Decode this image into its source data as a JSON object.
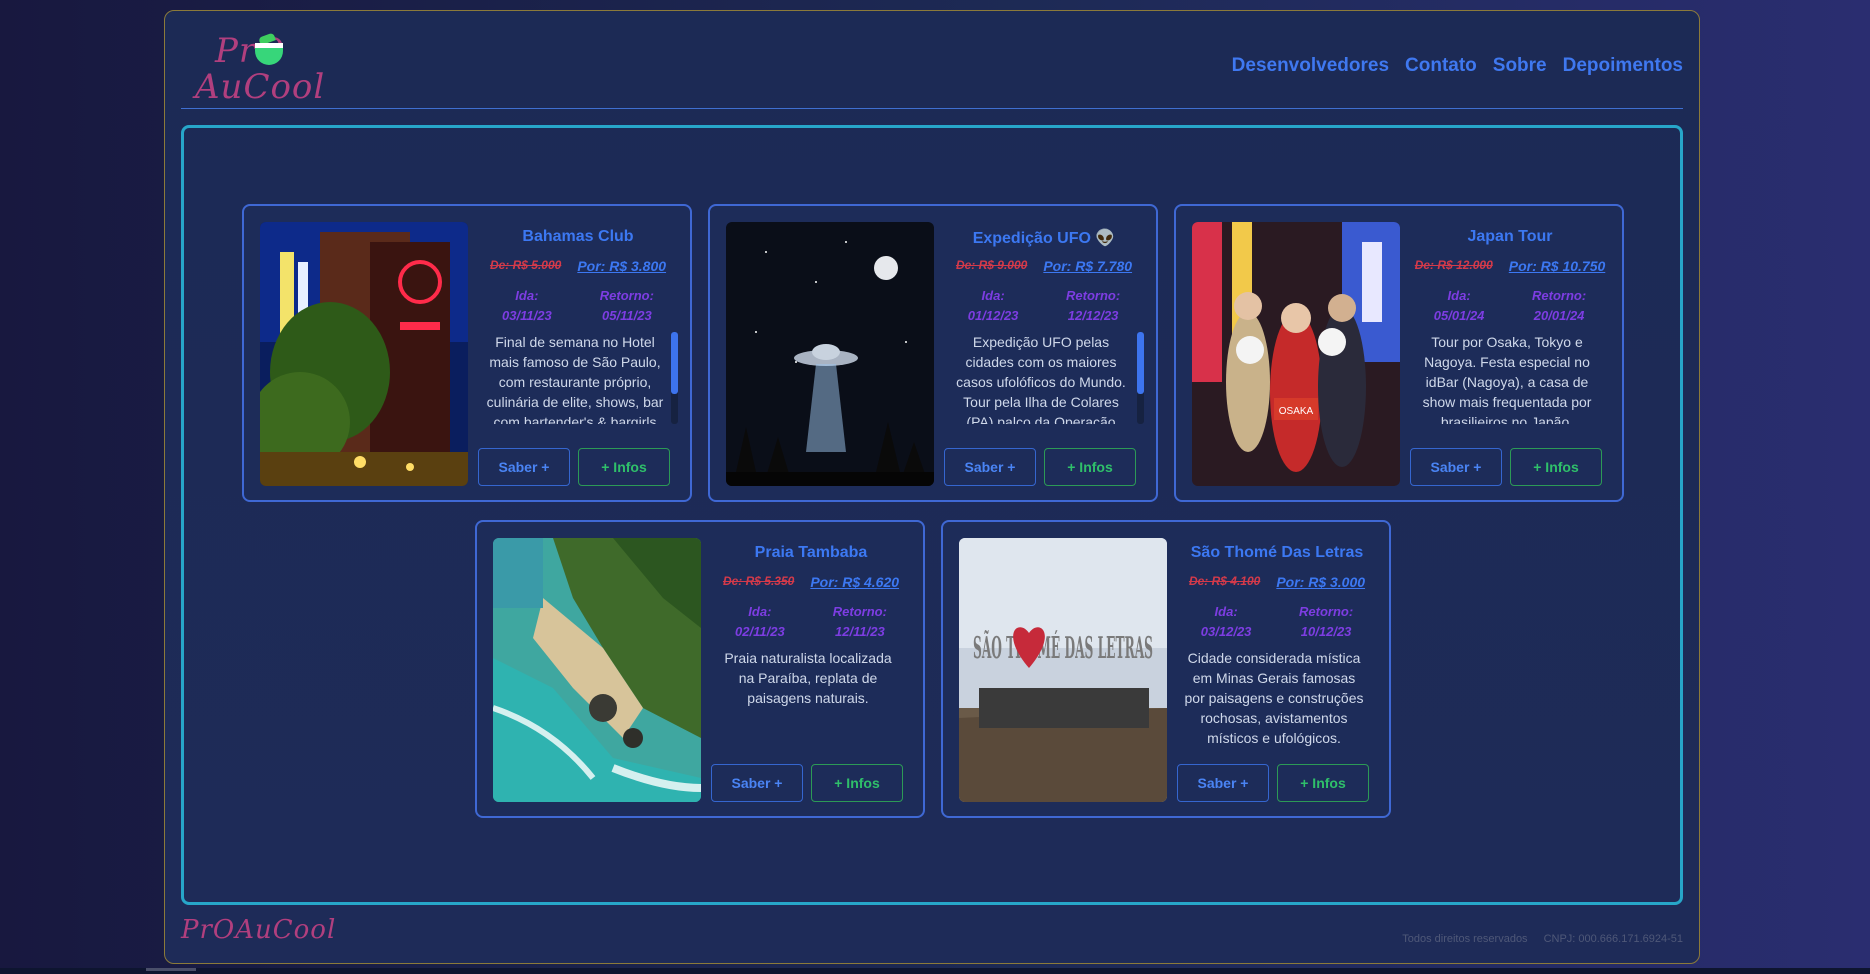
{
  "header": {
    "logo_line1": "PrO",
    "logo_line2": "AuCool",
    "nav": [
      "Desenvolvedores",
      "Contato",
      "Sobre",
      "Depoimentos"
    ]
  },
  "cards": [
    {
      "title": "Bahamas Club",
      "old_price": "De: R$ 5.000",
      "new_price": "Por: R$ 3.800",
      "ida_label": "Ida:",
      "ida": "03/11/23",
      "retorno_label": "Retorno:",
      "retorno": "05/11/23",
      "description": "Final de semana no Hotel mais famoso de São Paulo, com restaurante próprio, culinária de elite, shows, bar com bartender's & bargirls",
      "saber": "Saber +",
      "infos": "+ Infos"
    },
    {
      "title": "Expedição UFO 👽",
      "old_price": "De: R$ 9.000",
      "new_price": "Por: R$ 7.780",
      "ida_label": "Ida:",
      "ida": "01/12/23",
      "retorno_label": "Retorno:",
      "retorno": "12/12/23",
      "description": "Expedição UFO pelas cidades com os maiores casos ufolóficos do Mundo. Tour pela Ilha de Colares (PA) palco da Operação",
      "saber": "Saber +",
      "infos": "+ Infos"
    },
    {
      "title": "Japan Tour",
      "old_price": "De: R$ 12.000",
      "new_price": "Por: R$ 10.750",
      "ida_label": "Ida:",
      "ida": "05/01/24",
      "retorno_label": "Retorno:",
      "retorno": "20/01/24",
      "description": "Tour por Osaka, Tokyo e Nagoya. Festa especial no idBar (Nagoya), a casa de show mais frequentada por brasilieiros no Japão.",
      "saber": "Saber +",
      "infos": "+ Infos"
    },
    {
      "title": "Praia Tambaba",
      "old_price": "De: R$ 5.350",
      "new_price": "Por: R$ 4.620",
      "ida_label": "Ida:",
      "ida": "02/11/23",
      "retorno_label": "Retorno:",
      "retorno": "12/11/23",
      "description": "Praia naturalista localizada na Paraíba, replata de paisagens naturais.",
      "saber": "Saber +",
      "infos": "+ Infos"
    },
    {
      "title": "São Thomé Das Letras",
      "old_price": "De: R$ 4.100",
      "new_price": "Por: R$ 3.000",
      "ida_label": "Ida:",
      "ida": "03/12/23",
      "retorno_label": "Retorno:",
      "retorno": "10/12/23",
      "description": "Cidade considerada mística em Minas Gerais famosas por paisagens e construções rochosas, avistamentos místicos e ufológicos.",
      "saber": "Saber +",
      "infos": "+ Infos"
    }
  ],
  "photo_labels": {
    "osaka_sign": "OSAKA",
    "sao_thome_sign": "SÃO THOMÉ DAS LETRAS"
  },
  "footer": {
    "logo": "PrOAuCool",
    "rights": "Todos direitos reservados",
    "cnpj": "CNPJ: 000.666.171.6924-51"
  },
  "colors": {
    "accent": "#3c78f2",
    "old_price": "#d43a4a",
    "dates": "#7d3de2",
    "infos": "#2fc06a",
    "main_border": "#27a6c9"
  }
}
